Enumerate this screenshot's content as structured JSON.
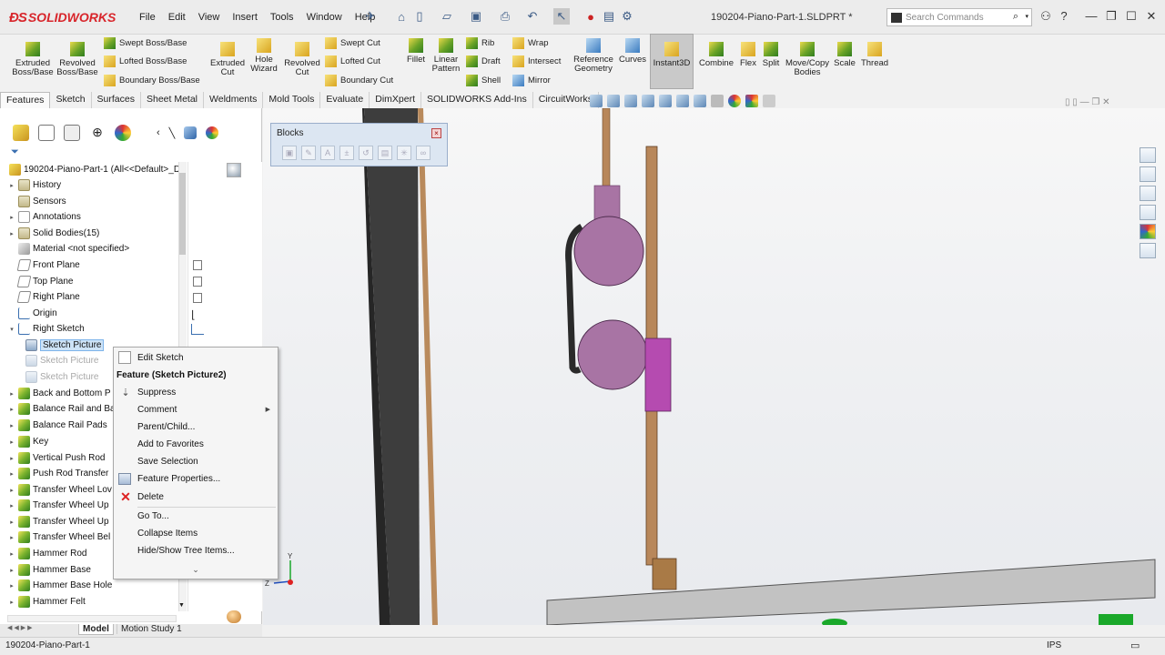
{
  "app": {
    "brand": "SOLIDWORKS",
    "document_title": "190204-Piano-Part-1.SLDPRT *"
  },
  "menu": [
    "File",
    "Edit",
    "View",
    "Insert",
    "Tools",
    "Window",
    "Help"
  ],
  "search": {
    "placeholder": "Search Commands"
  },
  "ribbon": {
    "extruded_boss": "Extruded Boss/Base",
    "revolved_boss": "Revolved Boss/Base",
    "swept_boss": "Swept Boss/Base",
    "lofted_boss": "Lofted Boss/Base",
    "boundary_boss": "Boundary Boss/Base",
    "extruded_cut": "Extruded Cut",
    "hole_wizard": "Hole Wizard",
    "revolved_cut": "Revolved Cut",
    "swept_cut": "Swept Cut",
    "lofted_cut": "Lofted Cut",
    "boundary_cut": "Boundary Cut",
    "fillet": "Fillet",
    "linear_pattern": "Linear Pattern",
    "rib": "Rib",
    "draft": "Draft",
    "shell": "Shell",
    "wrap": "Wrap",
    "intersect": "Intersect",
    "mirror": "Mirror",
    "reference_geometry": "Reference Geometry",
    "curves": "Curves",
    "instant3d": "Instant3D",
    "combine": "Combine",
    "flex": "Flex",
    "split": "Split",
    "move_copy": "Move/Copy Bodies",
    "scale": "Scale",
    "thread": "Thread"
  },
  "cm_tabs": [
    "Features",
    "Sketch",
    "Surfaces",
    "Sheet Metal",
    "Weldments",
    "Mold Tools",
    "Evaluate",
    "DimXpert",
    "SOLIDWORKS Add-Ins",
    "CircuitWorks"
  ],
  "tree": {
    "root": "190204-Piano-Part-1  (All<<Default>_D",
    "items": [
      "History",
      "Sensors",
      "Annotations",
      "Solid Bodies(15)",
      "Material <not specified>",
      "Front Plane",
      "Top Plane",
      "Right Plane",
      "Origin",
      "Right Sketch",
      "Sketch Picture",
      "Sketch Picture",
      "Sketch Picture",
      "Back and Bottom P",
      "Balance Rail and Ba",
      "Balance Rail Pads",
      "Key",
      "Vertical Push Rod",
      "Push Rod Transfer",
      "Transfer Wheel Lov",
      "Transfer Wheel Up",
      "Transfer Wheel Up",
      "Transfer Wheel Bel",
      "Hammer Rod",
      "Hammer Base",
      "Hammer Base Hole",
      "Hammer Felt"
    ]
  },
  "bottom_tabs": {
    "model": "Model",
    "motion": "Motion Study 1"
  },
  "blocks": {
    "title": "Blocks"
  },
  "context_menu": {
    "edit_sketch": "Edit Sketch",
    "header": "Feature (Sketch Picture2)",
    "suppress": "Suppress",
    "comment": "Comment",
    "parent_child": "Parent/Child...",
    "add_favorites": "Add to Favorites",
    "save_selection": "Save Selection",
    "feature_properties": "Feature Properties...",
    "delete": "Delete",
    "go_to": "Go To...",
    "collapse": "Collapse Items",
    "hide_show": "Hide/Show Tree Items..."
  },
  "status": {
    "left": "190204-Piano-Part-1",
    "units": "IPS"
  },
  "triad": {
    "y": "Y",
    "z": "Z"
  },
  "colors": {
    "brand": "#d8252b",
    "selection": "#cde3f7",
    "pink": "#a874a4",
    "magenta": "#b54bb0",
    "wood": "#b8875a"
  }
}
